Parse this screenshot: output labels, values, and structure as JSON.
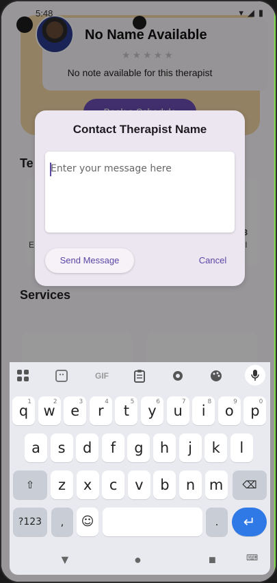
{
  "status": {
    "time": "5:48"
  },
  "profile": {
    "name": "No Name Available",
    "rating_stars": "★★★★★",
    "note": "No note available for this therapist",
    "book_button": "Book a Schedule"
  },
  "sections": {
    "team_title": "Te",
    "team_left_label": "E",
    "team_right_title": "t 3",
    "team_right_sub": "pful",
    "services_title": "Services"
  },
  "dialog": {
    "title": "Contact Therapist Name",
    "input_placeholder": "Enter your message here",
    "send_label": "Send Message",
    "cancel_label": "Cancel"
  },
  "keyboard": {
    "row1": [
      {
        "k": "q",
        "s": "1"
      },
      {
        "k": "w",
        "s": "2"
      },
      {
        "k": "e",
        "s": "3"
      },
      {
        "k": "r",
        "s": "4"
      },
      {
        "k": "t",
        "s": "5"
      },
      {
        "k": "y",
        "s": "6"
      },
      {
        "k": "u",
        "s": "7"
      },
      {
        "k": "i",
        "s": "8"
      },
      {
        "k": "o",
        "s": "9"
      },
      {
        "k": "p",
        "s": "0"
      }
    ],
    "row2": [
      "a",
      "s",
      "d",
      "f",
      "g",
      "h",
      "j",
      "k",
      "l"
    ],
    "row3": [
      "z",
      "x",
      "c",
      "v",
      "b",
      "n",
      "m"
    ],
    "symbols_key": "?123",
    "comma_key": ",",
    "period_key": ".",
    "gif_label": "GIF"
  },
  "icons": {
    "apps": "apps-icon",
    "sticker": "sticker-icon",
    "gif": "gif-icon",
    "clipboard": "clipboard-icon",
    "settings": "gear-icon",
    "palette": "palette-icon",
    "mic": "mic-icon",
    "shift": "shift-icon",
    "backspace": "backspace-icon",
    "emoji": "emoji-icon",
    "enter": "enter-icon"
  },
  "colors": {
    "accent": "#6b4fb5",
    "dialog_bg": "#ece6f0",
    "header_bg": "#f6d7a7",
    "enter_key": "#2f79e6"
  }
}
